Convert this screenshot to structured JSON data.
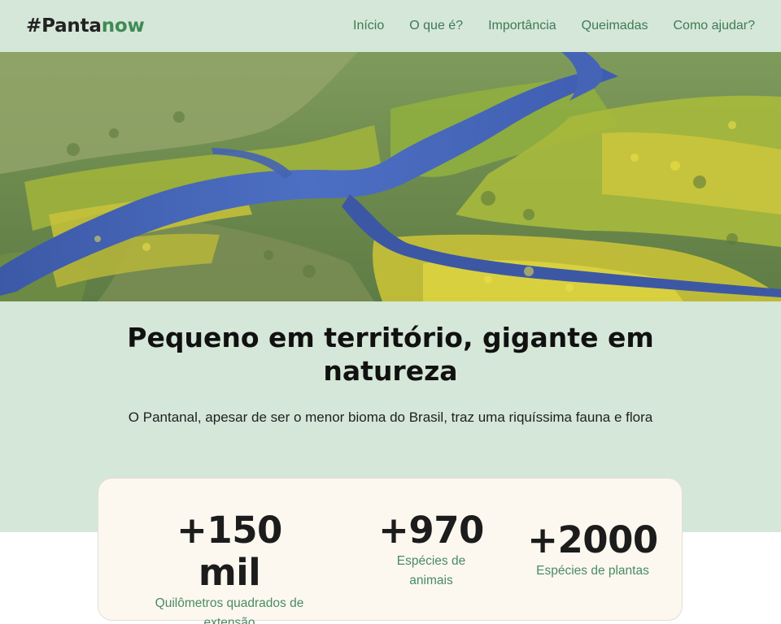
{
  "header": {
    "logo_main": "#Panta",
    "logo_accent": "now",
    "nav": [
      {
        "label": "Início"
      },
      {
        "label": "O que é?"
      },
      {
        "label": "Importância"
      },
      {
        "label": "Queimadas"
      },
      {
        "label": "Como ajudar?"
      }
    ]
  },
  "intro": {
    "title": "Pequeno em território, gigante em natureza",
    "text": "O Pantanal, apesar de ser o menor bioma do Brasil, traz uma riquíssima fauna e flora"
  },
  "stats": [
    {
      "value": "+150 mil",
      "label": "Quilômetros quadrados de extensão"
    },
    {
      "value": "+970",
      "label": "Espécies de animais"
    },
    {
      "value": "+2000",
      "label": "Espécies de plantas"
    }
  ],
  "colors": {
    "header_bg": "#d5e7d8",
    "accent": "#3f8a55",
    "nav_text": "#3e7a55",
    "card_bg": "#fcf8ef"
  }
}
